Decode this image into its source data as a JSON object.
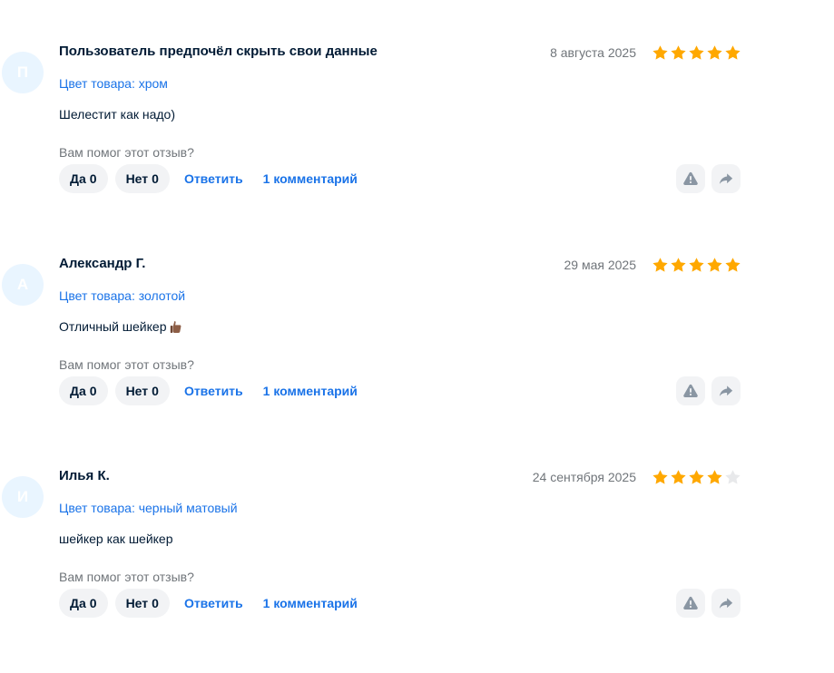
{
  "labels": {
    "color_prefix": "Цвет товара:",
    "helpful_question": "Вам помог этот отзыв?",
    "yes": "Да",
    "no": "Нет",
    "reply": "Ответить"
  },
  "colors": {
    "accent": "#1a73e8",
    "star_on": "#ffa800",
    "star_off": "#e8e9eb",
    "avatar_bg": "#e9f5ff",
    "pill_bg": "#f2f3f5"
  },
  "icons": {
    "star": "star-icon",
    "report": "warning-triangle-icon",
    "share": "share-arrow-icon",
    "thumb": "thumbs-up-emoji-icon"
  },
  "reviews": [
    {
      "initial": "П",
      "author": "Пользователь предпочёл скрыть свои данные",
      "date": "8 августа 2025",
      "rating": 5,
      "color_text": "Цвет товара: хром",
      "text": "Шелестит как надо)",
      "has_emoji": false,
      "yes_count": "0",
      "no_count": "0",
      "comments": "1 комментарий"
    },
    {
      "initial": "А",
      "author": "Александр Г.",
      "date": "29 мая 2025",
      "rating": 5,
      "color_text": "Цвет товара: золотой",
      "text": "Отличный шейкер",
      "has_emoji": true,
      "yes_count": "0",
      "no_count": "0",
      "comments": "1 комментарий"
    },
    {
      "initial": "И",
      "author": "Илья К.",
      "date": "24 сентября 2025",
      "rating": 4,
      "color_text": "Цвет товара: черный матовый",
      "text": "шейкер как шейкер",
      "has_emoji": false,
      "yes_count": "0",
      "no_count": "0",
      "comments": "1 комментарий"
    }
  ]
}
